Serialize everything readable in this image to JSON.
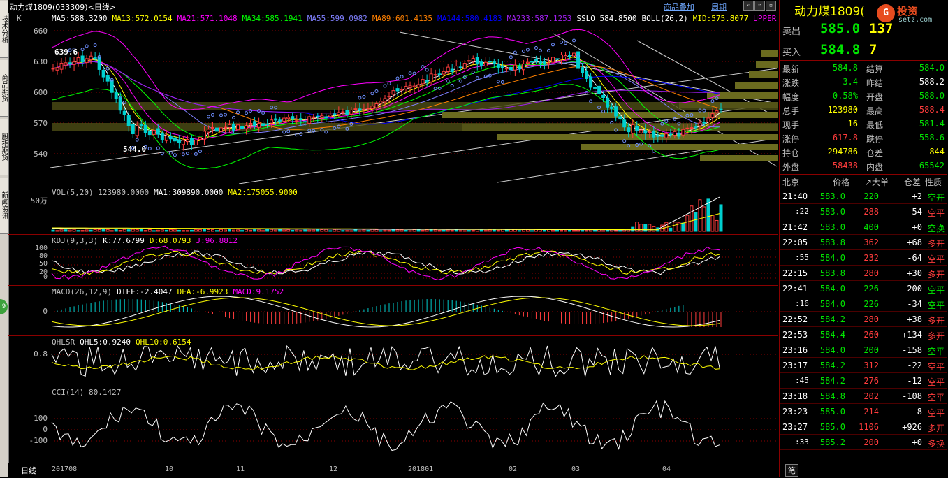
{
  "header": {
    "title": "动力煤1809(033309)<日线>",
    "overlay_link": "商品叠加",
    "period_link": "周期",
    "nav_buttons": [
      "⇐",
      "⇒",
      "▫"
    ]
  },
  "left_tabs": [
    "技术分析",
    "商品期货",
    "股指期货",
    "新闻资讯"
  ],
  "left_badge": "9",
  "price_pane": {
    "label": "K",
    "legend": [
      {
        "text": "MA5:588.3200",
        "color": "#ffffff"
      },
      {
        "text": "MA13:572.0154",
        "color": "#ffff00"
      },
      {
        "text": "MA21:571.1048",
        "color": "#ff00ff"
      },
      {
        "text": "MA34:585.1941",
        "color": "#00ff00"
      },
      {
        "text": "MA55:599.0982",
        "color": "#8080ff"
      },
      {
        "text": "MA89:601.4135",
        "color": "#ff8000"
      },
      {
        "text": "MA144:580.4183",
        "color": "#0000ff"
      },
      {
        "text": "MA233:587.1253",
        "color": "#a020f0"
      },
      {
        "text": "SSLO  584.8500",
        "color": "#ffffff"
      },
      {
        "text": "BOLL(26,2)",
        "color": "#ffffff"
      },
      {
        "text": "MID:575.8077",
        "color": "#ffff00"
      },
      {
        "text": "UPPER",
        "color": "#ff00ff"
      }
    ],
    "y_ticks": [
      "660",
      "630",
      "600",
      "570",
      "540"
    ],
    "high_label": "639.6",
    "low_label": "544.0"
  },
  "vol_pane": {
    "legend": [
      {
        "text": "VOL(5,20)  123980.0000",
        "color": "#c0c0c0"
      },
      {
        "text": "MA1:309890.0000",
        "color": "#ffffff"
      },
      {
        "text": "MA2:175055.9000",
        "color": "#ffff00"
      }
    ],
    "y_ticks": [
      "50万"
    ]
  },
  "kdj_pane": {
    "legend": [
      {
        "text": "KDJ(9,3,3)",
        "color": "#c0c0c0"
      },
      {
        "text": "K:77.6799",
        "color": "#ffffff"
      },
      {
        "text": "D:68.0793",
        "color": "#ffff00"
      },
      {
        "text": "J:96.8812",
        "color": "#ff00ff"
      }
    ],
    "y_ticks": [
      "100",
      "80",
      "50",
      "20",
      "0"
    ]
  },
  "macd_pane": {
    "legend": [
      {
        "text": "MACD(26,12,9)",
        "color": "#c0c0c0"
      },
      {
        "text": "DIFF:-2.4047",
        "color": "#ffffff"
      },
      {
        "text": "DEA:-6.9923",
        "color": "#ffff00"
      },
      {
        "text": "MACD:9.1752",
        "color": "#ff00ff"
      }
    ],
    "y_ticks": [
      "0"
    ]
  },
  "qhlsr_pane": {
    "legend": [
      {
        "text": "QHLSR",
        "color": "#c0c0c0"
      },
      {
        "text": "QHL5:0.9240",
        "color": "#ffffff"
      },
      {
        "text": "QHL10:0.6154",
        "color": "#ffff00"
      }
    ],
    "y_ticks": [
      "0.8"
    ]
  },
  "cci_pane": {
    "legend": [
      {
        "text": "CCI(14)  80.1427",
        "color": "#c0c0c0"
      }
    ],
    "y_ticks": [
      "100",
      "0",
      "-100"
    ]
  },
  "x_axis": {
    "mode": "日线",
    "labels": [
      "201708",
      "10",
      "11",
      "12",
      "201801",
      "02",
      "03",
      "04"
    ]
  },
  "quote": {
    "name": "动力煤1809(",
    "logo_text": "投资",
    "logo_url": "setz.com",
    "sell": {
      "label": "卖出",
      "price": "585.0",
      "vol": "137"
    },
    "buy": {
      "label": "买入",
      "price": "584.8",
      "vol": "7"
    },
    "stats": [
      {
        "l1": "最新",
        "v1": "584.8",
        "c1": "dn",
        "l2": "结算",
        "v2": "584.0",
        "c2": "dn"
      },
      {
        "l1": "涨跌",
        "v1": "-3.4",
        "c1": "dn",
        "l2": "昨结",
        "v2": "588.2",
        "c2": "wh"
      },
      {
        "l1": "幅度",
        "v1": "-0.58%",
        "c1": "dn",
        "l2": "开盘",
        "v2": "588.0",
        "c2": "dn"
      },
      {
        "l1": "总手",
        "v1": "123980",
        "c1": "yl",
        "l2": "最高",
        "v2": "588.4",
        "c2": "up"
      },
      {
        "l1": "现手",
        "v1": "16",
        "c1": "yl",
        "l2": "最低",
        "v2": "581.4",
        "c2": "dn"
      },
      {
        "l1": "涨停",
        "v1": "617.8",
        "c1": "up",
        "l2": "跌停",
        "v2": "558.6",
        "c2": "dn"
      },
      {
        "l1": "持仓",
        "v1": "294786",
        "c1": "yl",
        "l2": "仓差",
        "v2": "844",
        "c2": "yl"
      },
      {
        "l1": "外盘",
        "v1": "58438",
        "c1": "up",
        "l2": "内盘",
        "v2": "65542",
        "c2": "dn"
      }
    ],
    "tick_header": [
      "北京",
      "价格",
      "↗大单",
      "仓差",
      "性质"
    ],
    "ticks": [
      {
        "t": "21:40",
        "p": "583.0",
        "v": "220",
        "vc": "dn",
        "d": "+2",
        "n": "空开",
        "nc": "dn"
      },
      {
        "t": ":22",
        "p": "583.0",
        "v": "288",
        "vc": "up",
        "d": "-54",
        "n": "空平",
        "nc": "up"
      },
      {
        "t": "21:42",
        "p": "583.0",
        "v": "400",
        "vc": "dn",
        "d": "+0",
        "n": "空换",
        "nc": "dn"
      },
      {
        "t": "22:05",
        "p": "583.8",
        "v": "362",
        "vc": "up",
        "d": "+68",
        "n": "多开",
        "nc": "up"
      },
      {
        "t": ":55",
        "p": "584.0",
        "v": "232",
        "vc": "up",
        "d": "-64",
        "n": "空平",
        "nc": "up"
      },
      {
        "t": "22:15",
        "p": "583.8",
        "v": "280",
        "vc": "up",
        "d": "+30",
        "n": "多开",
        "nc": "up"
      },
      {
        "t": "22:41",
        "p": "584.0",
        "v": "226",
        "vc": "dn",
        "d": "-200",
        "n": "空平",
        "nc": "dn"
      },
      {
        "t": ":16",
        "p": "584.0",
        "v": "226",
        "vc": "dn",
        "d": "-34",
        "n": "空平",
        "nc": "dn"
      },
      {
        "t": "22:52",
        "p": "584.2",
        "v": "280",
        "vc": "up",
        "d": "+38",
        "n": "多开",
        "nc": "up"
      },
      {
        "t": "22:53",
        "p": "584.4",
        "v": "260",
        "vc": "up",
        "d": "+134",
        "n": "多开",
        "nc": "up"
      },
      {
        "t": "23:16",
        "p": "584.0",
        "v": "200",
        "vc": "dn",
        "d": "-158",
        "n": "空平",
        "nc": "dn"
      },
      {
        "t": "23:17",
        "p": "584.2",
        "v": "312",
        "vc": "up",
        "d": "-22",
        "n": "空平",
        "nc": "up"
      },
      {
        "t": ":45",
        "p": "584.2",
        "v": "276",
        "vc": "up",
        "d": "-12",
        "n": "空平",
        "nc": "up"
      },
      {
        "t": "23:18",
        "p": "584.8",
        "v": "202",
        "vc": "up",
        "d": "-108",
        "n": "空平",
        "nc": "up"
      },
      {
        "t": "23:23",
        "p": "585.0",
        "v": "214",
        "vc": "up",
        "d": "-8",
        "n": "空平",
        "nc": "up"
      },
      {
        "t": "23:27",
        "p": "585.0",
        "v": "1106",
        "vc": "up",
        "d": "+926",
        "n": "多开",
        "nc": "up"
      },
      {
        "t": ":33",
        "p": "585.2",
        "v": "200",
        "vc": "up",
        "d": "+0",
        "n": "多换",
        "nc": "up"
      }
    ],
    "footer_tab": "笔"
  },
  "colors": {
    "up": "#ff3c3c",
    "down": "#00e600",
    "grid": "#8b0000",
    "accent": "#ffff00"
  }
}
